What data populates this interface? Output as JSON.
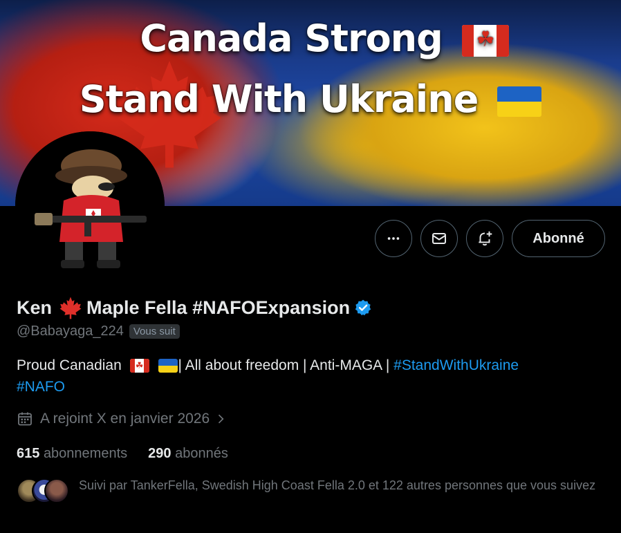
{
  "banner": {
    "line1": "Canada Strong",
    "line2": "Stand With Ukraine"
  },
  "actions": {
    "more_icon": "more-icon",
    "message_icon": "mail-icon",
    "notify_icon": "bell-plus-icon",
    "follow_label": "Abonné"
  },
  "profile": {
    "name_part1": "Ken",
    "name_part2": "Maple Fella #NAFOExpansion",
    "verified_icon": "verified-badge-icon",
    "handle": "@Babayaga_224",
    "follows_you": "Vous suit",
    "bio_part1": "Proud Canadian",
    "bio_part2": "| All about freedom | Anti-MAGA |",
    "bio_tag1": "#StandWithUkraine",
    "bio_tag2": "#NAFO",
    "joined": "A rejoint X en janvier 2026"
  },
  "stats": {
    "following_count": "615",
    "following_label": "abonnements",
    "followers_count": "290",
    "followers_label": "abonnés"
  },
  "followed_by": {
    "text": "Suivi par TankerFella, Swedish High Coast Fella 2.0 et 122 autres personnes que vous suivez"
  },
  "colors": {
    "accent": "#1d9bf0",
    "background": "#000000",
    "muted": "#71767b",
    "text": "#e7e9ea"
  }
}
